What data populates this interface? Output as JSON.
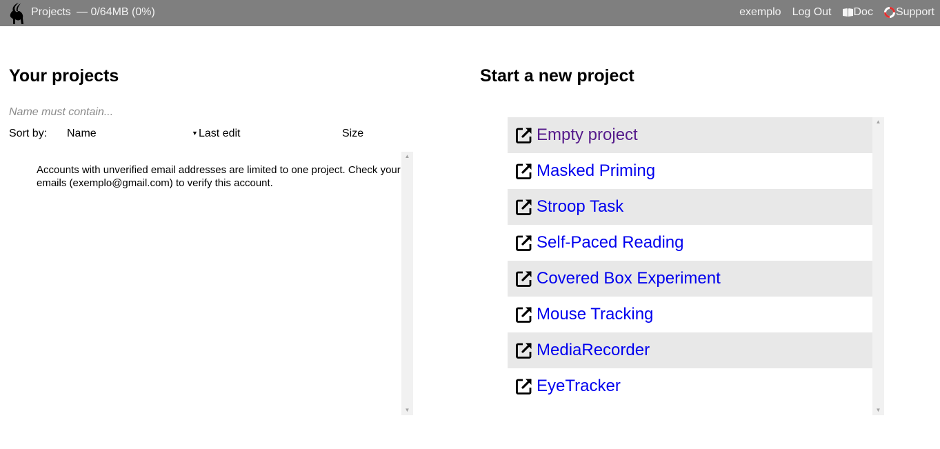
{
  "topbar": {
    "title": "Projects",
    "usage": "— 0/64MB (0%)",
    "user": "exemplo",
    "logout": "Log Out",
    "doc": "Doc",
    "support": "Support",
    "bg_color": "#7f7f7f",
    "icons": {
      "logo": "ibex-logo-icon",
      "doc": "book-icon",
      "support": "lifebuoy-icon"
    }
  },
  "left": {
    "heading": "Your projects",
    "filter_placeholder": "Name must contain...",
    "filter_value": "",
    "sort_label": "Sort by:",
    "columns": {
      "name": "Name",
      "last_edit": "Last edit",
      "size": "Size"
    },
    "active_sort": "Last edit",
    "message": "Accounts with unverified email addresses are limited to one project. Check your emails (exemplo@gmail.com) to verify this account."
  },
  "right": {
    "heading": "Start a new project",
    "templates": [
      {
        "name": "Empty project",
        "visited": true
      },
      {
        "name": "Masked Priming",
        "visited": false
      },
      {
        "name": "Stroop Task",
        "visited": false
      },
      {
        "name": "Self-Paced Reading",
        "visited": false
      },
      {
        "name": "Covered Box Experiment",
        "visited": false
      },
      {
        "name": "Mouse Tracking",
        "visited": false
      },
      {
        "name": "MediaRecorder",
        "visited": false
      },
      {
        "name": "EyeTracker",
        "visited": false
      }
    ],
    "item_icon": "external-link-icon",
    "colors": {
      "link": "#0000ee",
      "visited": "#551a8b",
      "stripe": "#e8e8e8"
    }
  }
}
